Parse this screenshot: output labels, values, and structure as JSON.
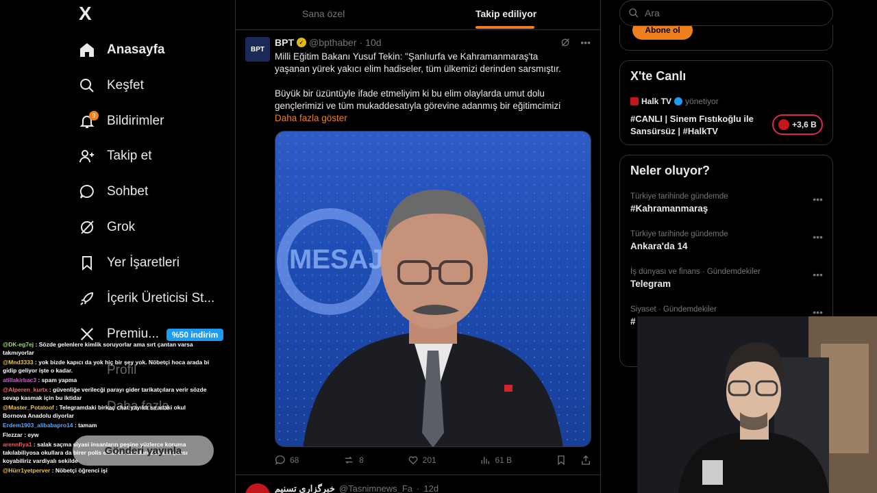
{
  "nav": {
    "logo": "X",
    "items": [
      {
        "label": "Anasayfa",
        "icon": "home-icon",
        "active": true
      },
      {
        "label": "Keşfet",
        "icon": "search-icon"
      },
      {
        "label": "Bildirimler",
        "icon": "bell-icon",
        "badge": "9"
      },
      {
        "label": "Takip et",
        "icon": "follow-icon"
      },
      {
        "label": "Sohbet",
        "icon": "chat-icon"
      },
      {
        "label": "Grok",
        "icon": "grok-icon"
      },
      {
        "label": "Yer İşaretleri",
        "icon": "bookmark-icon"
      },
      {
        "label": "İçerik Üreticisi St...",
        "icon": "rocket-icon"
      },
      {
        "label": "Premiu...",
        "icon": "x-logo-icon"
      }
    ],
    "premium_badge": "%50 indirim",
    "profile": "Profil",
    "more": "Daha fazla",
    "post_button": "Gönderi yayınla"
  },
  "chat": [
    {
      "user": "@DK-eg7ej",
      "text": "Sözde gelenlere kimlik soruyorlar ama sırt çantan varsa takmıyorlar",
      "color": "#9be36b"
    },
    {
      "user": "@Mnd3333",
      "text": "yok bizde kapıcı da yok hiç bir şey yok. Nöbetçi hoca arada bi gidip geliyor işte o kadar.",
      "color": "#f0c24a"
    },
    {
      "user": "atillakirbac3",
      "text": "spam yapma",
      "color": "#d45ad4"
    },
    {
      "user": "@Alperen_kurtx",
      "text": "güvenliğe verilecği parayı gider tarikatçılara verir sözde sevap kasmak için bu iktidar",
      "color": "#ff6b6b"
    },
    {
      "user": "@Master_Potatoof",
      "text": "Telegramdaki birkaç chat yayıldı sıradaki okul Bornova Anadolu diyorlar",
      "color": "#f0c24a"
    },
    {
      "user": "Erdem1903_alibabapro14",
      "text": "tamam",
      "color": "#5aa7ff"
    },
    {
      "user": "Flezzar",
      "text": "eyw",
      "color": "#ffffff"
    },
    {
      "user": "arennflya1",
      "text": "salak saçma siyasi insanların peşine yüzlerce koruma takılabiliyosa okullara da birer polis ekibi en azından 2 silahlı şahsı koyabiliriz vardiyalı sekilde",
      "color": "#ff5a5a"
    },
    {
      "user": "@Hürr1yetperver",
      "text": "Nöbetçi öğrenci işi",
      "color": "#f0c24a"
    }
  ],
  "feed": {
    "tabs": [
      "Sana özel",
      "Takip ediliyor"
    ],
    "active_tab": "Takip ediliyor",
    "tweet": {
      "avatar_text": "BPT",
      "name": "BPT",
      "handle": "@bpthaber",
      "time": "10d",
      "text1": "Milli Eğitim Bakanı Yusuf Tekin: \"Şanlıurfa ve Kahramanmaraş'ta yaşanan yürek yakıcı elim hadiseler, tüm ülkemizi derinden sarsmıştır.",
      "text2": "Büyük bir üzüntüyle ifade etmeliyim ki bu elim olaylarda umut dolu gençlerimizi ve tüm mukaddesatıyla görevine adanmış bir eğitimcimizi",
      "show_more": "Daha fazla göster",
      "image_text": "MESAJI",
      "replies": "68",
      "reposts": "8",
      "likes": "201",
      "views": "61 B"
    },
    "tweet2": {
      "name": "خبرگزاری تسنیم",
      "handle": "@Tasnimnews_Fa",
      "time": "12d"
    }
  },
  "right": {
    "search_placeholder": "Ara",
    "subscribe": "Abone ol",
    "live": {
      "heading": "X'te Canlı",
      "host": "Halk TV",
      "host_suffix": "yönetiyor",
      "title": "#CANLI | Sinem Fıstıkoğlu ile Sansürsüz | #HalkTV",
      "count": "+3,6 B"
    },
    "trends_heading": "Neler oluyor?",
    "trends": [
      {
        "context": "Türkiye tarihinde gündemde",
        "title": "#Kahramanmaraş"
      },
      {
        "context": "Türkiye tarihinde gündemde",
        "title": "Ankara'da 14"
      },
      {
        "context": "İş dünyası ve finans · Gündemdekiler",
        "title": "Telegram"
      },
      {
        "context": "Siyaset · Gündemdekiler",
        "title": "#"
      }
    ]
  }
}
